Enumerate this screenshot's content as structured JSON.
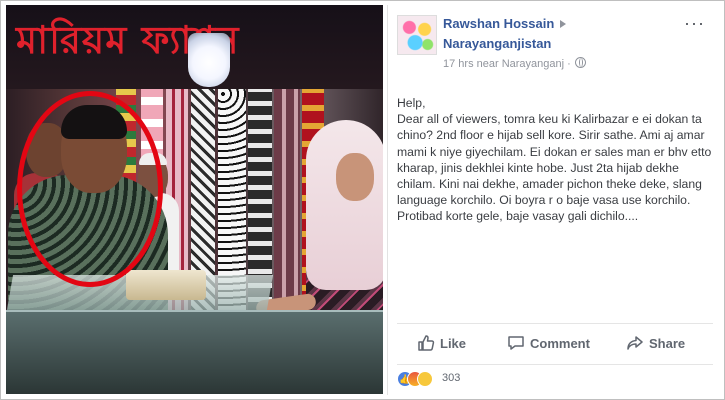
{
  "photo": {
    "sign_text": "মারিয়ম ফ্যাশন"
  },
  "post": {
    "author": "Rawshan Hossain",
    "group": "Narayanganjistan",
    "meta": "17 hrs near Narayanganj ·",
    "more": "···",
    "text": "Help,\nDear all of viewers, tomra keu ki Kalirbazar e ei dokan ta chino? 2nd floor e hijab sell kore. Sirir sathe. Ami aj amar mami k niye giyechilam. Ei dokan er sales man er bhv etto kharap, jinis dekhlei kinte hobe. Just 2ta hijab dekhe chilam. Kini nai dekhe, amader pichon theke deke, slang language korchilo. Oi boyra r o baje vasa use korchilo. Protibad korte gele, baje vasay gali dichilo....",
    "actions": {
      "like": "Like",
      "comment": "Comment",
      "share": "Share"
    },
    "reaction_count": "303",
    "reaction_icons": [
      "like-icon",
      "angry-icon",
      "sad-icon"
    ],
    "colors": {
      "link": "#365899",
      "circle": "#e30613"
    }
  }
}
